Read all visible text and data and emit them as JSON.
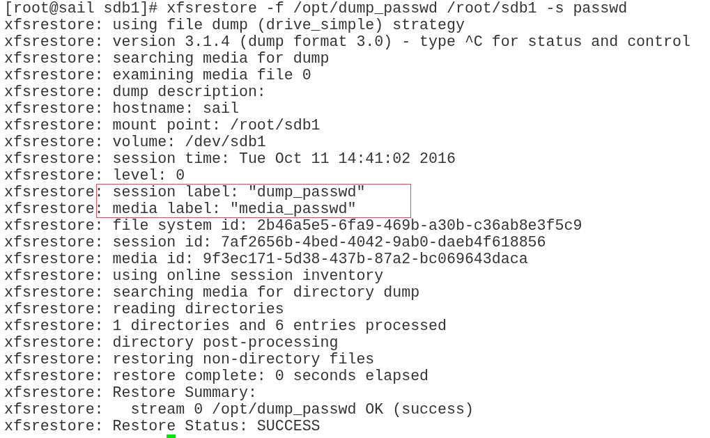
{
  "terminal": {
    "lines": [
      {
        "text": "[root@sail sdb1]# xfsrestore -f /opt/dump_passwd /root/sdb1 -s passwd",
        "boxed": false
      },
      {
        "text": "xfsrestore: using file dump (drive_simple) strategy",
        "boxed": false
      },
      {
        "text": "xfsrestore: version 3.1.4 (dump format 3.0) - type ^C for status and control",
        "boxed": false
      },
      {
        "text": "xfsrestore: searching media for dump",
        "boxed": false
      },
      {
        "text": "xfsrestore: examining media file 0",
        "boxed": false
      },
      {
        "text": "xfsrestore: dump description:",
        "boxed": false
      },
      {
        "text": "xfsrestore: hostname: sail",
        "boxed": false
      },
      {
        "text": "xfsrestore: mount point: /root/sdb1",
        "boxed": false
      },
      {
        "text": "xfsrestore: volume: /dev/sdb1",
        "boxed": false
      },
      {
        "text": "xfsrestore: session time: Tue Oct 11 14:41:02 2016",
        "boxed": false
      },
      {
        "text": "xfsrestore: level: 0",
        "boxed": false
      },
      {
        "text": "xfsrestore: session label: \"dump_passwd\"",
        "boxed": true
      },
      {
        "text": "xfsrestore: media label: \"media_passwd\"",
        "boxed": true
      },
      {
        "text": "xfsrestore: file system id: 2b46a5e5-6fa9-469b-a30b-c36ab8e3f5c9",
        "boxed": false
      },
      {
        "text": "xfsrestore: session id: 7af2656b-4bed-4042-9ab0-daeb4f618856",
        "boxed": false
      },
      {
        "text": "xfsrestore: media id: 9f3ec171-5d38-437b-87a2-bc069643daca",
        "boxed": false
      },
      {
        "text": "xfsrestore: using online session inventory",
        "boxed": false
      },
      {
        "text": "xfsrestore: searching media for directory dump",
        "boxed": false
      },
      {
        "text": "xfsrestore: reading directories",
        "boxed": false
      },
      {
        "text": "xfsrestore: 1 directories and 6 entries processed",
        "boxed": false
      },
      {
        "text": "xfsrestore: directory post-processing",
        "boxed": false
      },
      {
        "text": "xfsrestore: restoring non-directory files",
        "boxed": false
      },
      {
        "text": "xfsrestore: restore complete: 0 seconds elapsed",
        "boxed": false
      },
      {
        "text": "xfsrestore: Restore Summary:",
        "boxed": false
      },
      {
        "text": "xfsrestore:   stream 0 /opt/dump_passwd OK (success)",
        "boxed": false
      },
      {
        "text": "xfsrestore: Restore Status: SUCCESS",
        "boxed": false
      }
    ],
    "cursor_visible": true
  }
}
